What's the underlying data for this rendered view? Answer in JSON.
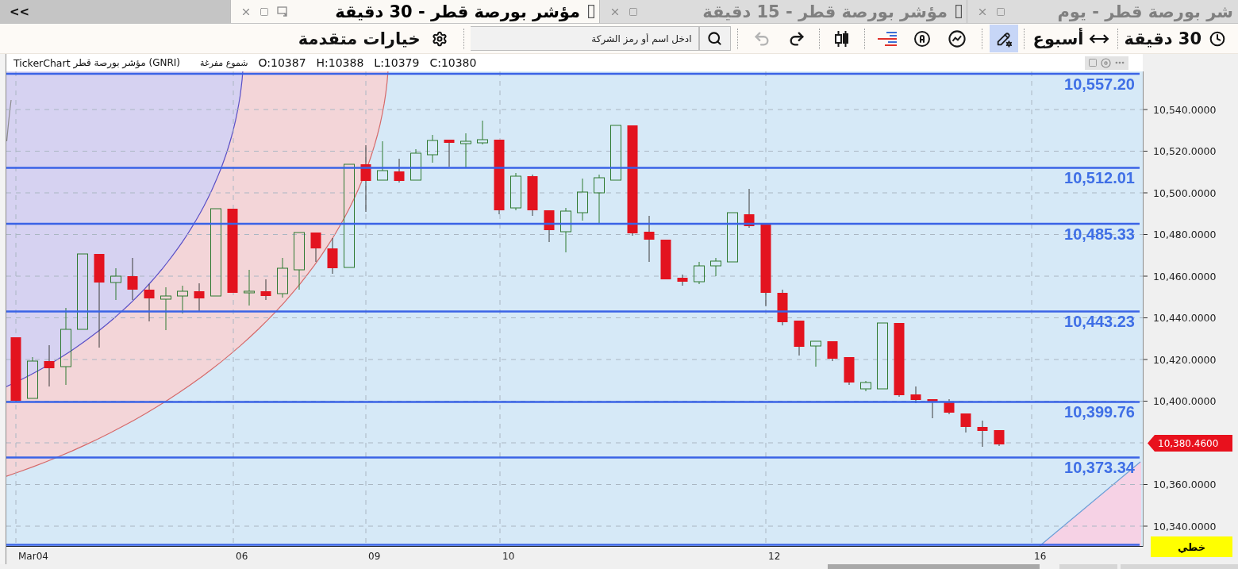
{
  "tab_strip": {
    "scroll_button": "<<"
  },
  "tabs": [
    {
      "title": "شر بورصة قطر - يوم",
      "selected": false
    },
    {
      "title": "مؤشر بورصة قطر - 15 دقيقة",
      "selected": false
    },
    {
      "title": "مؤشر بورصة قطر - 30 دقيقة",
      "selected": true
    }
  ],
  "toolbar": {
    "interval": "30 دقيقة",
    "period": "أسبوع",
    "tools": [
      {
        "selected": true
      },
      {
        "selected": false
      },
      {
        "selected": false
      },
      {
        "selected": false
      },
      {
        "selected": false
      }
    ],
    "history": [
      {
        "disabled": false
      },
      {
        "disabled": true
      }
    ],
    "search": {
      "placeholder": "ادخل اسم أو رمز الشركة"
    },
    "advanced_options": "خيارات متقدمة"
  },
  "chart": {
    "ohlc": [
      "C:10380",
      "L:10379",
      "H:10388",
      "O:10387"
    ],
    "style": "شموع مفرغة",
    "instrument": "مؤشر بورصة قطر (GNRI)",
    "source": "TickerChart",
    "levels": [
      {
        "label": "10,557.20"
      },
      {
        "label": "10,512.01"
      },
      {
        "label": "10,485.33"
      },
      {
        "label": "10,443.23"
      },
      {
        "label": "10,399.76"
      },
      {
        "label": "10,373.34"
      }
    ],
    "price_ticks": [
      "10,540.0000",
      "10,520.0000",
      "10,500.0000",
      "10,480.0000",
      "10,460.0000",
      "10,440.0000",
      "10,420.0000",
      "10,400.0000",
      "10,360.0000",
      "10,340.0000"
    ],
    "last_price": "10,380.4600",
    "chart_type": "خطي",
    "date_ticks": [
      "16",
      "12",
      "10",
      "09",
      "06",
      "Mar04"
    ]
  }
}
